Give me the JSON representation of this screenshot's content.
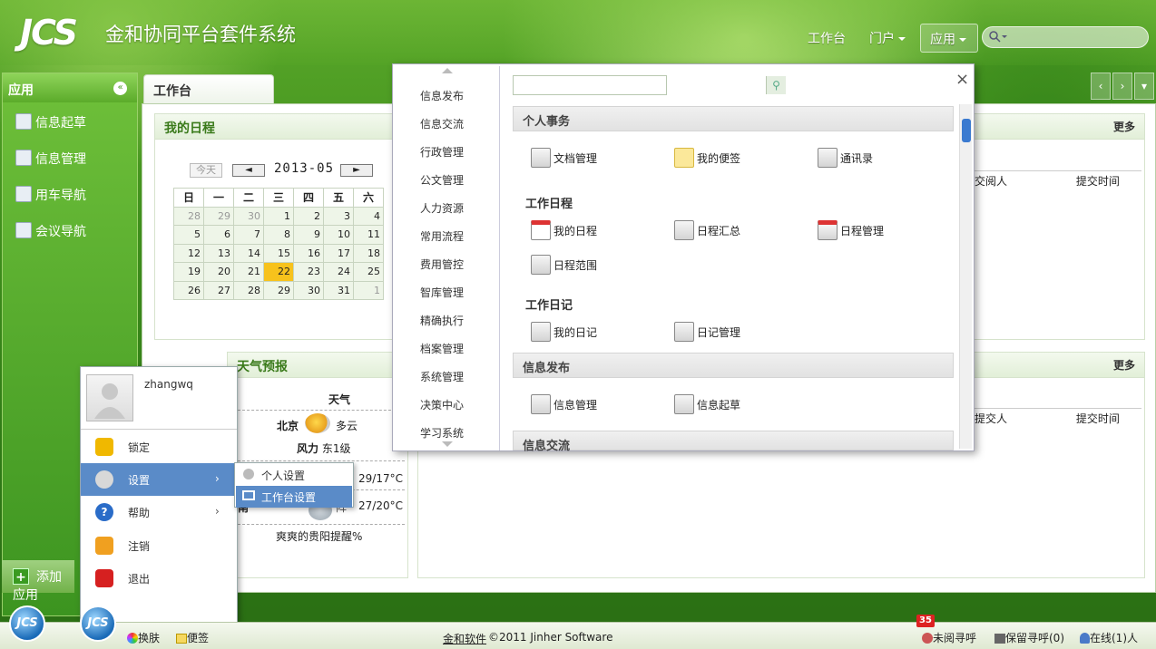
{
  "header": {
    "logo_text": "JCS",
    "title": "金和协同平台套件系统",
    "nav": [
      "工作台",
      "门户",
      "应用"
    ]
  },
  "left_panel": {
    "title": "应用",
    "items": [
      "信息起草",
      "信息管理",
      "用车导航",
      "会议导航"
    ],
    "add_label": "添加应用"
  },
  "tab": {
    "label": "工作台"
  },
  "schedule": {
    "title": "我的日程",
    "today_btn": "今天",
    "prev": "◄",
    "next": "►",
    "month": "2013-05",
    "weekdays": [
      "日",
      "一",
      "二",
      "三",
      "四",
      "五",
      "六"
    ],
    "weeks": [
      [
        "28",
        "29",
        "30",
        "1",
        "2",
        "3",
        "4"
      ],
      [
        "5",
        "6",
        "7",
        "8",
        "9",
        "10",
        "11"
      ],
      [
        "12",
        "13",
        "14",
        "15",
        "16",
        "17",
        "18"
      ],
      [
        "19",
        "20",
        "21",
        "22",
        "23",
        "24",
        "25"
      ],
      [
        "26",
        "27",
        "28",
        "29",
        "30",
        "31",
        "1"
      ]
    ]
  },
  "right_panel1": {
    "more": "更多",
    "col1": "交阅人",
    "col2": "提交时间"
  },
  "right_panel2": {
    "more": "更多",
    "col1": "提交人",
    "col2": "提交时间"
  },
  "weather": {
    "title": "天气预报",
    "header": "天气",
    "city": "北京",
    "cond": "多云",
    "wind_label": "风力",
    "wind": "东1级",
    "temp1": "29/17°C",
    "city2": "南",
    "temp2_prefix": "阵",
    "temp2": "27/20°C",
    "note": "爽爽的贵阳提醒%"
  },
  "user_menu": {
    "username": "zhangwq",
    "items": [
      "锁定",
      "设置",
      "帮助",
      "注销",
      "退出"
    ]
  },
  "settings_sub": {
    "items": [
      "个人设置",
      "工作台设置"
    ]
  },
  "app_dropdown": {
    "categories": [
      "信息发布",
      "信息交流",
      "行政管理",
      "公文管理",
      "人力资源",
      "常用流程",
      "费用管控",
      "智库管理",
      "精确执行",
      "档案管理",
      "系统管理",
      "决策中心",
      "学习系统"
    ],
    "sections": {
      "personal": "个人事务",
      "info_pub": "信息发布",
      "info_exchange": "信息交流"
    },
    "personal_apps": [
      "文档管理",
      "我的便签",
      "通讯录"
    ],
    "schedule_head": "工作日程",
    "schedule_apps": [
      "我的日程",
      "日程汇总",
      "日程管理",
      "日程范围"
    ],
    "diary_head": "工作日记",
    "diary_apps": [
      "我的日记",
      "日记管理"
    ],
    "pub_apps": [
      "信息管理",
      "信息起草"
    ],
    "close": "×"
  },
  "statusbar": {
    "skin": "换肤",
    "note": "便签",
    "brand": "金和软件",
    "copyright": "©2011 Jinher Software",
    "badge": "35",
    "unread": "未阅寻呼",
    "kept": "保留寻呼(0)",
    "online": "在线(1)人"
  }
}
